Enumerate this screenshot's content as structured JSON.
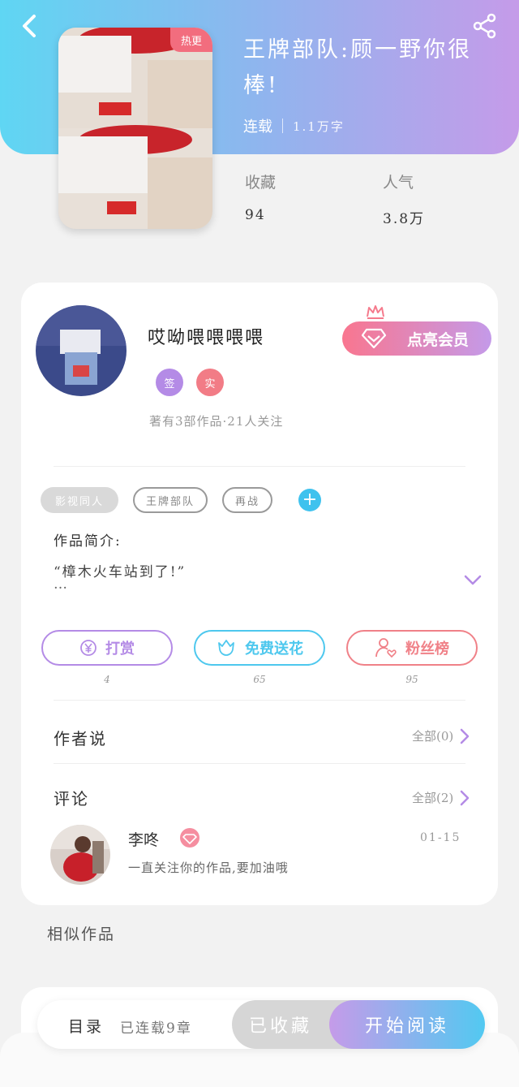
{
  "header": {
    "badge": "热更",
    "title": "王牌部队:顾一野你很棒!",
    "status": "连载",
    "word_count": "1.1万字",
    "stats": [
      {
        "label": "收藏",
        "value": "94"
      },
      {
        "label": "人气",
        "value": "3.8万"
      }
    ]
  },
  "author": {
    "name": "哎呦喂喂喂喂",
    "vip_button": "点亮会员",
    "badges": [
      {
        "text": "签",
        "color": "#b48be6"
      },
      {
        "text": "实",
        "color": "#f27c86"
      }
    ],
    "info": "著有3部作品·21人关注"
  },
  "tags": {
    "items": [
      "影视同人",
      "王牌部队",
      "再战"
    ]
  },
  "intro": {
    "label": "作品简介:",
    "text": "“樟木火车站到了!”",
    "ellipsis": "…"
  },
  "actions": [
    {
      "label": "打赏",
      "count": "4",
      "color": "#b48be6"
    },
    {
      "label": "免费送花",
      "count": "65",
      "color": "#4ec8ee"
    },
    {
      "label": "粉丝榜",
      "count": "95",
      "color": "#f08188"
    }
  ],
  "author_says": {
    "title": "作者说",
    "more": "全部(0)"
  },
  "comments": {
    "title": "评论",
    "more": "全部(2)",
    "items": [
      {
        "user": "李咚",
        "date": "01-15",
        "text": "一直关注你的作品,要加油哦"
      }
    ]
  },
  "similar": {
    "title": "相似作品"
  },
  "bottom_bar": {
    "toc": "目录",
    "toc_count": "已连载9章",
    "fav": "已收藏",
    "read": "开始阅读"
  },
  "colors": {
    "accent_purple": "#b48be6",
    "accent_blue": "#4ec8ee",
    "accent_pink": "#f08188"
  }
}
